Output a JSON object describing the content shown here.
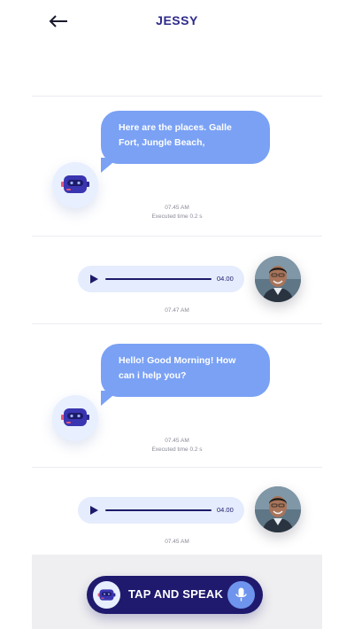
{
  "header": {
    "title": "JESSY",
    "back_icon": "arrow-left-icon"
  },
  "messages": [
    {
      "type": "bot",
      "text": "Here are the places. Galle Fort, Jungle Beach,",
      "time": "07.45 AM",
      "exec": "Executed time 0.2 s"
    },
    {
      "type": "user_audio",
      "duration": "04.00",
      "time": "07.47 AM"
    },
    {
      "type": "bot",
      "text": "Hello! Good Morning! How can i help you?",
      "time": "07.45 AM",
      "exec": "Executed time 0.2 s"
    },
    {
      "type": "user_audio",
      "duration": "04.00",
      "time": "07.45 AM"
    }
  ],
  "footer": {
    "speak_label": "TAP AND SPEAK",
    "bot_icon": "robot-icon",
    "mic_icon": "microphone-icon"
  },
  "colors": {
    "primary": "#1f1a6e",
    "bubble": "#7aa1f4",
    "audio_bg": "#e5ecfd",
    "bot_bg": "#e8efff",
    "footer_bg": "#efeff1"
  }
}
